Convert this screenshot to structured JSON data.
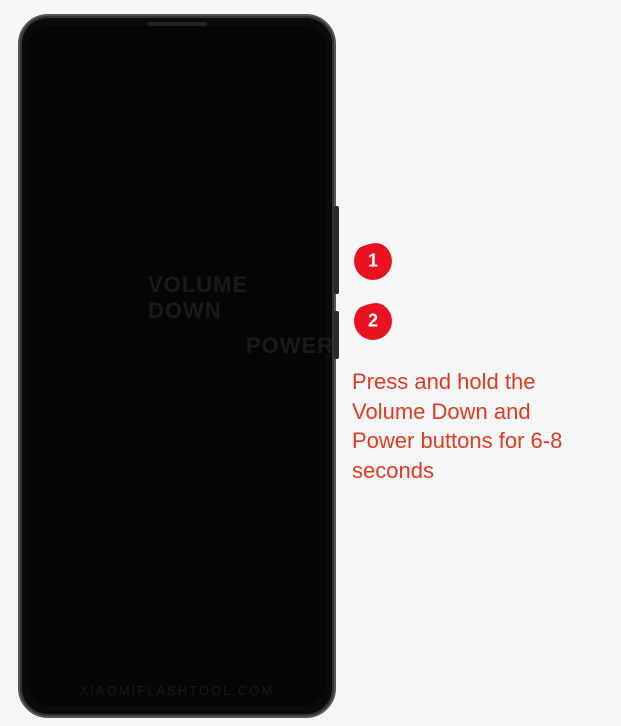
{
  "labels": {
    "volume_down": "VOLUME DOWN",
    "power": "POWER"
  },
  "markers": {
    "one": "1",
    "two": "2"
  },
  "instruction": "Press and hold the Volume Down and Power buttons for 6-8 seconds",
  "watermark": "XIAOMIFLASHTOOL.COM"
}
